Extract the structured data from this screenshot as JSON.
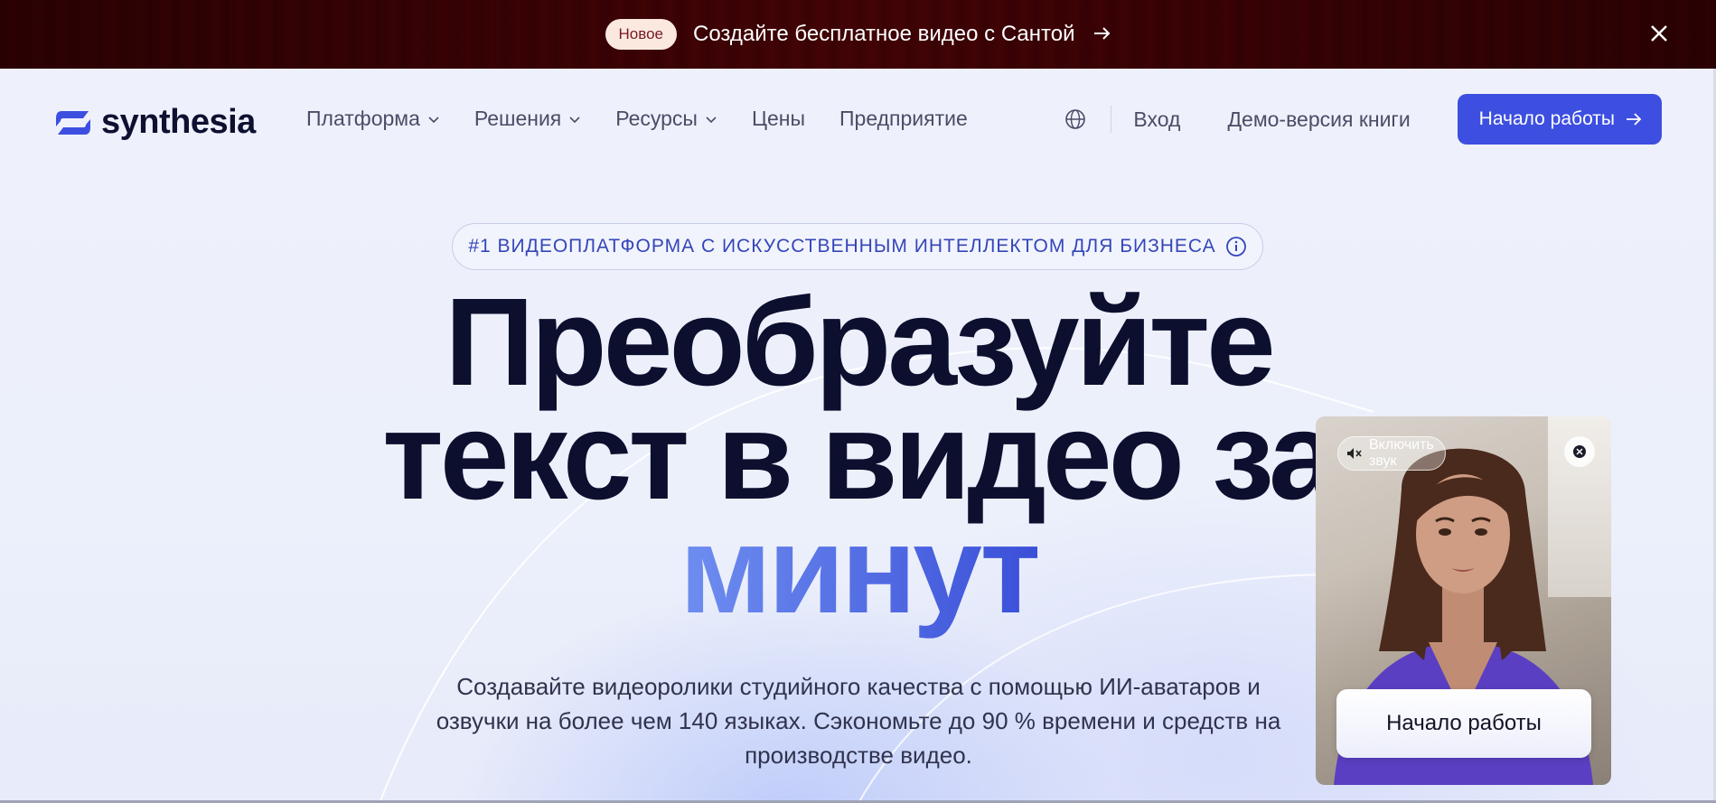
{
  "promo": {
    "badge": "Новое",
    "text": "Создайте бесплатное видео с Сантой",
    "arrow": "→"
  },
  "nav": {
    "logo_text": "synthesia",
    "menu": [
      {
        "label": "Платформа",
        "has_dropdown": true
      },
      {
        "label": "Решения",
        "has_dropdown": true
      },
      {
        "label": "Ресурсы",
        "has_dropdown": true
      },
      {
        "label": "Цены",
        "has_dropdown": false
      },
      {
        "label": "Предприятие",
        "has_dropdown": false
      }
    ],
    "login": "Вход",
    "demo": "Демо-версия книги",
    "cta": "Начало работы"
  },
  "hero": {
    "pill": "#1 ВИДЕОПЛАТФОРМА С ИСКУССТВЕННЫМ ИНТЕЛЛЕКТОМ ДЛЯ БИЗНЕСА",
    "title_line1": "Преобразуйте",
    "title_line2": "текст в видео за",
    "title_accent": "минут",
    "subtitle": "Создавайте видеоролики студийного качества с помощью ИИ-аватаров и озвучки на более чем 140 языках. Сэкономьте до 90 % времени и средств на производстве видео."
  },
  "video_widget": {
    "sound_label": "Включить звук",
    "cta": "Начало работы"
  },
  "colors": {
    "promo_bg": "#7a1a26",
    "accent": "#3d4fe0",
    "title": "#0c0f2e"
  }
}
